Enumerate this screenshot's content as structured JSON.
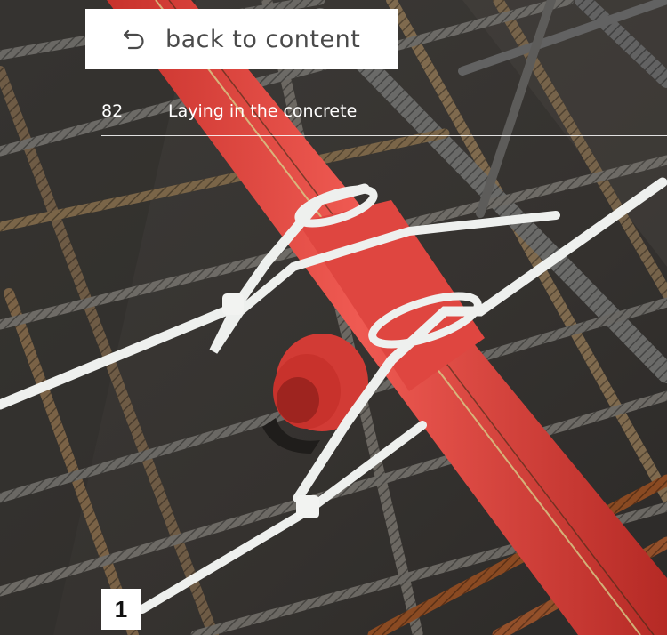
{
  "nav": {
    "back_label": "back to content",
    "back_icon": "undo-arrow-icon"
  },
  "section": {
    "number": "82",
    "title": "Laying in the concrete"
  },
  "step": {
    "number": "1"
  },
  "colors": {
    "pipe": "#e8453f",
    "rebar": "#6b6a66",
    "rust": "#8a4a22",
    "cable_tie": "#f2f3f1"
  }
}
